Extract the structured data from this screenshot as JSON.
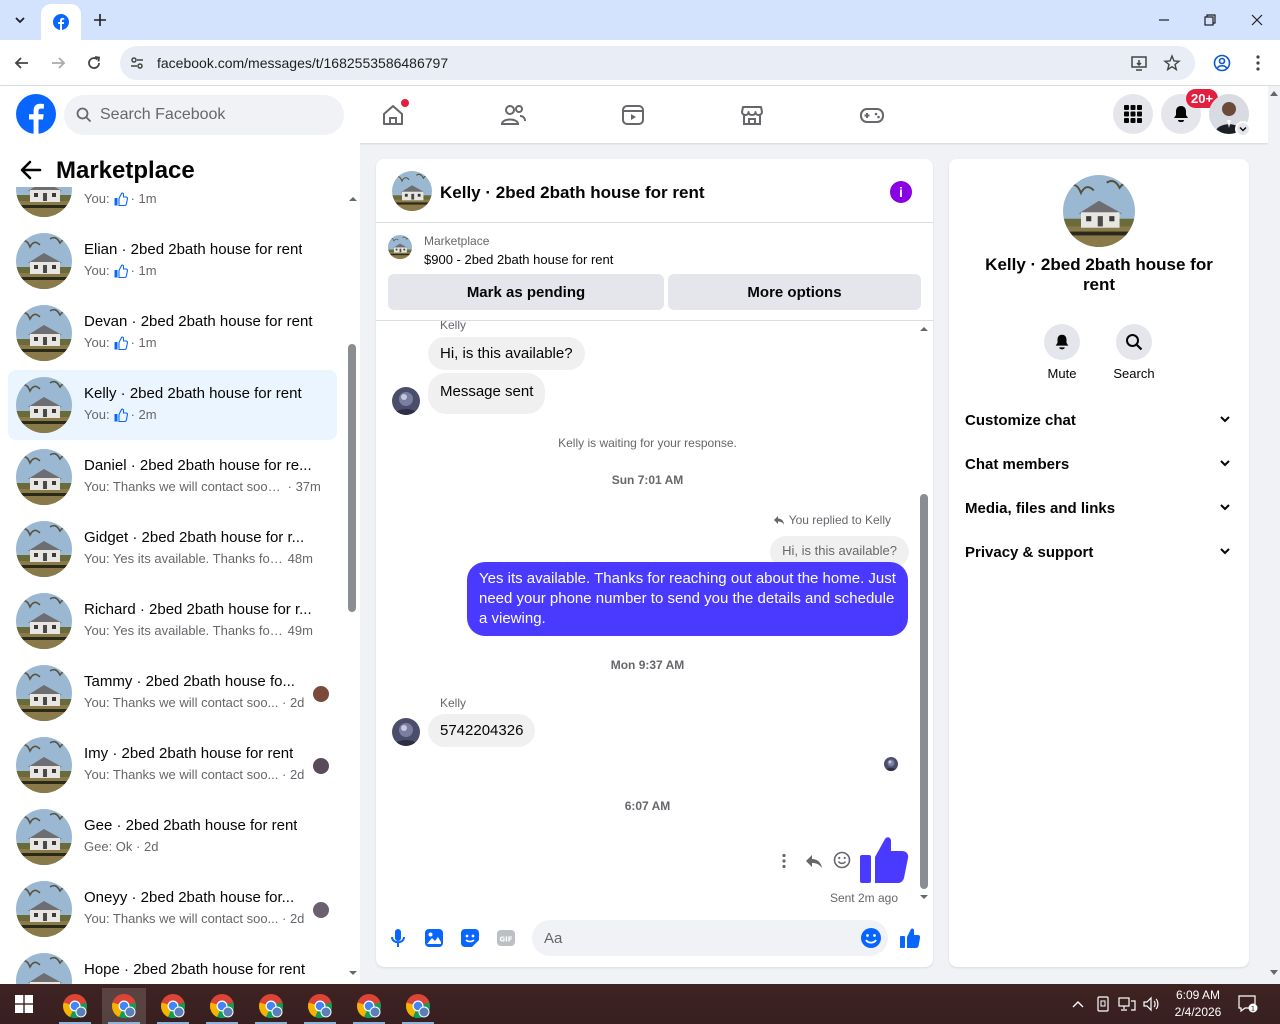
{
  "browser": {
    "url": "facebook.com/messages/t/1682553586486797"
  },
  "fb": {
    "search_placeholder": "Search Facebook",
    "notif_count": "20+"
  },
  "sidebar": {
    "title": "Marketplace",
    "conversations": [
      {
        "name": "",
        "snippet": "You:",
        "like": true,
        "time": "· 1m",
        "partial": true
      },
      {
        "name": "Elian · 2bed 2bath house for rent",
        "snippet": "You:",
        "like": true,
        "time": "· 1m"
      },
      {
        "name": "Devan · 2bed 2bath house for rent",
        "snippet": "You:",
        "like": true,
        "time": "· 1m"
      },
      {
        "name": "Kelly · 2bed 2bath house for rent",
        "snippet": "You:",
        "like": true,
        "time": "· 2m",
        "active": true
      },
      {
        "name": "Daniel · 2bed 2bath house for re...",
        "snippet": "You: Thanks we will contact soon ...",
        "time": "· 37m"
      },
      {
        "name": "Gidget · 2bed 2bath house for r...",
        "snippet": "You: Yes its available. Thanks for r...",
        "time": "48m"
      },
      {
        "name": "Richard · 2bed 2bath house for r...",
        "snippet": "You: Yes its available. Thanks for r...",
        "time": "49m"
      },
      {
        "name": "Tammy · 2bed 2bath house fo...",
        "snippet": "You: Thanks we will contact soo...",
        "time": "· 2d",
        "mini": "#7a4a3a"
      },
      {
        "name": "Imy · 2bed 2bath house for rent",
        "snippet": "You: Thanks we will contact soo...",
        "time": "· 2d",
        "mini": "#5a4a5a"
      },
      {
        "name": "Gee · 2bed 2bath house for rent",
        "snippet": "Gee: Ok",
        "time": "· 2d"
      },
      {
        "name": "Oneyy · 2bed 2bath house for...",
        "snippet": "You: Thanks we will contact soo...",
        "time": "· 2d",
        "mini": "#6a6070"
      },
      {
        "name": "Hope · 2bed 2bath house for rent",
        "snippet": "",
        "time": ""
      }
    ]
  },
  "chat": {
    "title": "Kelly · 2bed 2bath house for rent",
    "marketplace_label": "Marketplace",
    "listing": "$900 - 2bed 2bath house for rent",
    "mark_pending": "Mark as pending",
    "more_options": "More options",
    "sender_kelly": "Kelly",
    "msg1": "Hi, is this available?",
    "msg2": "Message sent",
    "waiting": "Kelly is waiting for your response.",
    "ts1": "Sun 7:01 AM",
    "replied_to": "You replied to Kelly",
    "quoted": "Hi, is this available?",
    "reply": "Yes its available. Thanks for reaching out about the home. Just need your phone number to send you the details and schedule a viewing.",
    "ts2": "Mon 9:37 AM",
    "sender_kelly2": "Kelly",
    "phone": "5742204326",
    "ts3": "6:07 AM",
    "sent_status": "Sent 2m ago",
    "composer_placeholder": "Aa"
  },
  "info": {
    "name": "Kelly · 2bed 2bath house for rent",
    "mute": "Mute",
    "search": "Search",
    "rows": [
      "Customize chat",
      "Chat members",
      "Media, files and links",
      "Privacy & support"
    ]
  },
  "taskbar": {
    "time": "6:09 AM",
    "date": "2/4/2026"
  },
  "colors": {
    "fb_blue": "#0866ff",
    "outgoing_bubble": "#4a3aff",
    "info_purple": "#8b00e3"
  }
}
